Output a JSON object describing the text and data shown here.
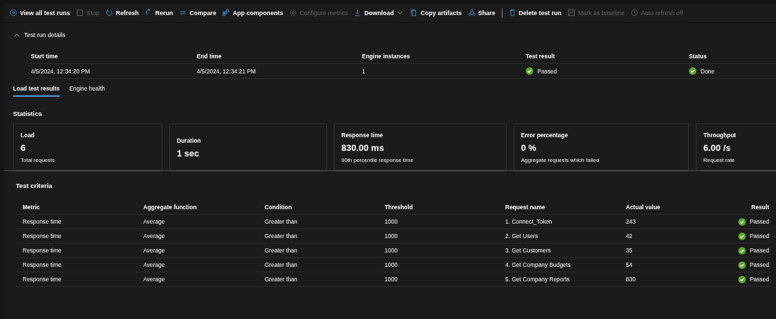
{
  "toolbar": [
    {
      "label": "View all test runs",
      "kind": "button",
      "disabled": false
    },
    {
      "label": "Stop",
      "kind": "button",
      "disabled": true
    },
    {
      "label": "Refresh",
      "kind": "button",
      "disabled": false
    },
    {
      "label": "Rerun",
      "kind": "button",
      "disabled": false
    },
    {
      "label": "Compare",
      "kind": "button",
      "disabled": false
    },
    {
      "label": "App components",
      "kind": "button",
      "disabled": false
    },
    {
      "label": "Configure metrics",
      "kind": "button",
      "disabled": true
    },
    {
      "label": "Download",
      "kind": "dropdown",
      "disabled": false
    },
    {
      "label": "Copy artifacts",
      "kind": "button",
      "disabled": false
    },
    {
      "label": "Share",
      "kind": "button",
      "disabled": false
    },
    {
      "kind": "separator"
    },
    {
      "label": "Delete test run",
      "kind": "button",
      "disabled": false
    },
    {
      "label": "Mark as baseline",
      "kind": "button",
      "disabled": true
    },
    {
      "label": "Auto refresh off",
      "kind": "button",
      "disabled": true
    }
  ],
  "run_details": {
    "title": "Test run details",
    "expanded": true,
    "columns": [
      "Start time",
      "End time",
      "Engine instances",
      "Test result",
      "Status"
    ],
    "row": [
      {
        "text": "4/5/2024, 12:34:20 PM"
      },
      {
        "text": "4/5/2024, 12:34:21 PM"
      },
      {
        "text": "1"
      },
      {
        "text": "Passed",
        "passed": true
      },
      {
        "text": "Done",
        "passed": true
      }
    ]
  },
  "tabs": [
    {
      "label": "Load test results",
      "selected": true
    },
    {
      "label": "Engine health",
      "selected": false
    }
  ],
  "statistics": {
    "title": "Statistics",
    "cards": [
      {
        "title": "Load",
        "value": "6",
        "caption": "Total requests"
      },
      {
        "title": "Duration",
        "value": "1 sec"
      },
      {
        "title": "Response time",
        "value": "830.00 ms",
        "caption": "90th percentile response time"
      },
      {
        "title": "Error percentage",
        "value": "0 %",
        "caption": "Aggregate requests which failed"
      },
      {
        "title": "Throughput",
        "value": "6.00 /s",
        "caption": "Request rate"
      }
    ]
  },
  "test_criteria": {
    "title": "Test criteria",
    "columns": [
      "Metric",
      "Aggregate function",
      "Condition",
      "Threshold",
      "Request name",
      "Actual value",
      "Result"
    ],
    "rows": [
      {
        "cells": [
          "Response time",
          "Average",
          "Greater than",
          "1000",
          "1. Connect_Token",
          "243"
        ],
        "result": "Passed",
        "passed": true
      },
      {
        "cells": [
          "Response time",
          "Average",
          "Greater than",
          "1000",
          "2. Get Users",
          "42"
        ],
        "result": "Passed",
        "passed": true
      },
      {
        "cells": [
          "Response time",
          "Average",
          "Greater than",
          "1000",
          "3. Get Customers",
          "35"
        ],
        "result": "Passed",
        "passed": true
      },
      {
        "cells": [
          "Response time",
          "Average",
          "Greater than",
          "1000",
          "4. Get Company Budgets",
          "54"
        ],
        "result": "Passed",
        "passed": true
      },
      {
        "cells": [
          "Response time",
          "Average",
          "Greater than",
          "1000",
          "5. Get Company Reports",
          "830"
        ],
        "result": "Passed",
        "passed": true
      }
    ]
  }
}
